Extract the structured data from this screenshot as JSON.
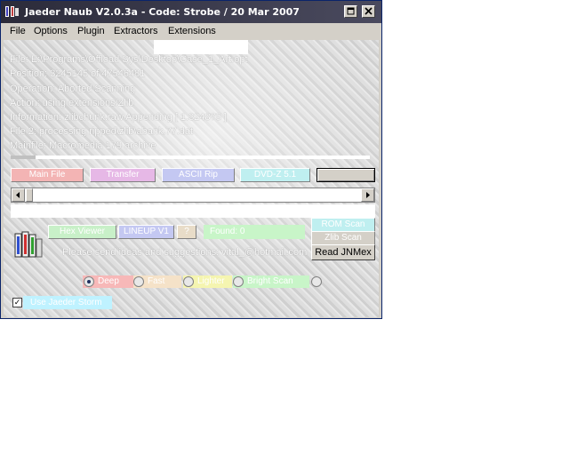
{
  "window": {
    "title": "Jaeder Naub V2.0.3a - Code:  Strobe / 20 Mar 2007",
    "minimize_glyph": "",
    "maximize_glyph": "□",
    "close_glyph": "✕"
  },
  "menu": [
    "File",
    "Options",
    "Plugin",
    "Extractors",
    "Extensions"
  ],
  "info": {
    "file": "File: E:\\Programs\\Offload Sys\\Desktop\\Case_1_Art.opt",
    "position": "Position:  3245145 of  47546481",
    "operation": "Operation: Aborted Scanning",
    "action": "Action: using extensions/Zlib",
    "information": "Information: zlibchunk.raw Appending [ 1.324875 ]",
    "file2": "File 2: processing ripped\\zlib\\abank.77.dat",
    "mainfile": "Mainfile: Macromedia 179 archive"
  },
  "progress": 0.07,
  "buttons": {
    "main_file": "Main File",
    "transfer": "Transfer",
    "ascii_rip": "ASCII Rip",
    "dvd_mode": "DVD-Z 5.1",
    "blank": ""
  },
  "scroll": {
    "left_arrow": "◂",
    "right_arrow": "▸"
  },
  "lower_buttons": {
    "hex_viewer": "Hex Viewer",
    "lineup": "LINEUP V1",
    "question": "?",
    "found": "Found: 0",
    "rom_scan": "ROM Scan",
    "zlib_scan": "Zlib Scan",
    "read_jnmex": "Read JNMex"
  },
  "suggestion": "Please send ideas and suggestions: vital_@hotmail.com",
  "radios": [
    {
      "label": "Deep",
      "selected": true,
      "color": "#f7b8b8"
    },
    {
      "label": "Fast",
      "selected": false,
      "color": "#f5e2c8"
    },
    {
      "label": "Lighter",
      "selected": false,
      "color": "#f5f5b0"
    },
    {
      "label": "Bright Scan",
      "selected": false,
      "color": "#c8f5c8"
    }
  ],
  "checkbox": {
    "label": "Use Jaeder Storm",
    "checked": true,
    "check_glyph": "✓"
  },
  "colors": {
    "title_bg": "#3a3a4c",
    "btn_pink": "#f3b4b4",
    "btn_magenta": "#e6b8e6",
    "btn_blue": "#c4c8f2",
    "btn_cyan": "#bfeff0",
    "btn_green": "#c8f0c8",
    "btn_tan": "#e8dcc8"
  }
}
